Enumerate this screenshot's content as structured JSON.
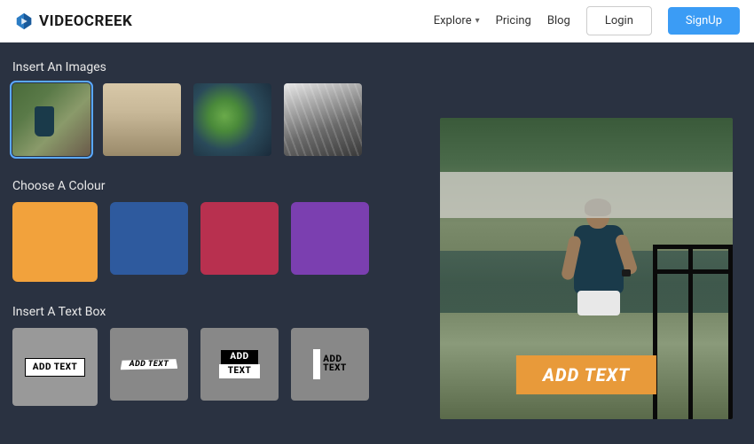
{
  "brand": "VIDEOCREEK",
  "nav": {
    "explore": "Explore",
    "pricing": "Pricing",
    "blog": "Blog",
    "login": "Login",
    "signup": "SignUp"
  },
  "sections": {
    "images": "Insert An Images",
    "color": "Choose A Colour",
    "textbox": "Insert A Text Box"
  },
  "colors": [
    "#f2a23c",
    "#2e5a9e",
    "#b8304f",
    "#7b3fb0"
  ],
  "textboxes": {
    "t1": "ADD TEXT",
    "t2": "ADD TEXT",
    "t3a": "ADD",
    "t3b": "TEXT",
    "t4a": "ADD",
    "t4b": "TEXT"
  },
  "preview": {
    "overlay_text": "ADD TEXT"
  }
}
